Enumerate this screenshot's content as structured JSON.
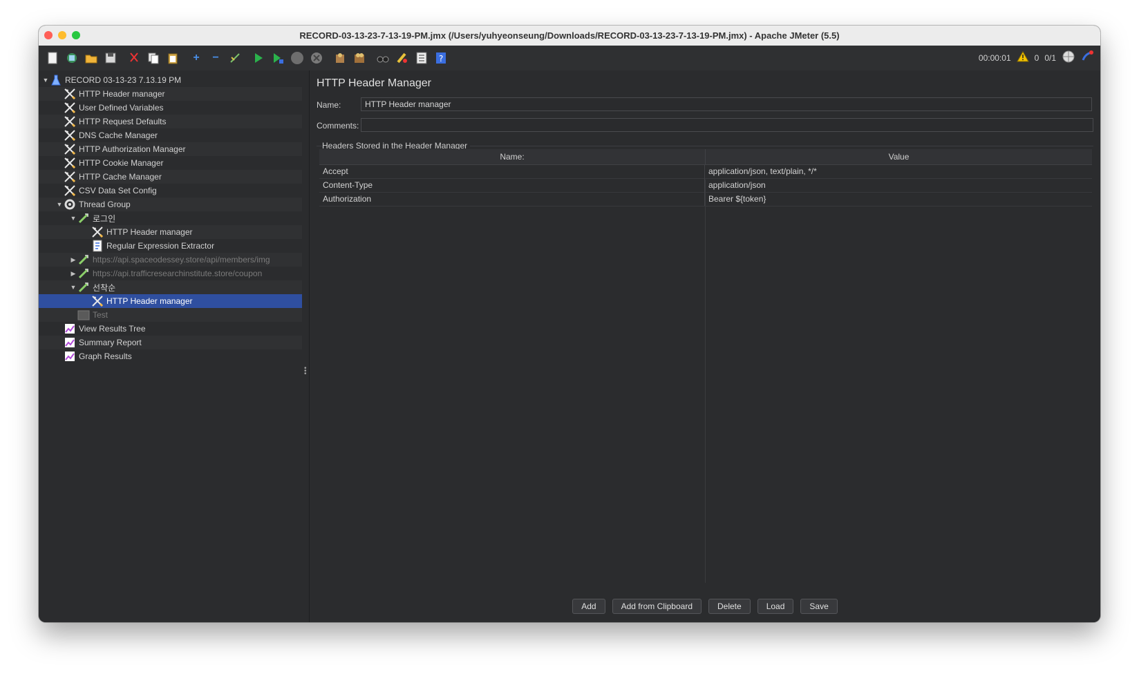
{
  "window": {
    "title": "RECORD-03-13-23-7-13-19-PM.jmx (/Users/yuhyeonseung/Downloads/RECORD-03-13-23-7-13-19-PM.jmx) - Apache JMeter (5.5)"
  },
  "toolbar": {
    "icons": [
      "new-icon",
      "templates-icon",
      "open-icon",
      "save-icon",
      "cut-icon",
      "copy-icon",
      "paste-icon",
      "expand-icon",
      "collapse-icon",
      "toggle-icon",
      "start-icon",
      "start-no-pauses-icon",
      "stop-icon",
      "shutdown-icon",
      "clear-icon",
      "clear-all-icon",
      "search-icon",
      "reset-search-icon",
      "function-helper-icon",
      "help-icon"
    ],
    "elapsed": "00:00:01",
    "warnings": "0",
    "threads": "0/1"
  },
  "tree": {
    "items": [
      {
        "label": "RECORD 03-13-23 7.13.19 PM",
        "icon": "test-plan-icon"
      },
      {
        "label": "HTTP Header manager",
        "icon": "config-element-icon"
      },
      {
        "label": "User Defined Variables",
        "icon": "config-element-icon"
      },
      {
        "label": "HTTP Request Defaults",
        "icon": "config-element-icon"
      },
      {
        "label": "DNS Cache Manager",
        "icon": "config-element-icon"
      },
      {
        "label": "HTTP Authorization Manager",
        "icon": "config-element-icon"
      },
      {
        "label": "HTTP Cookie Manager",
        "icon": "config-element-icon"
      },
      {
        "label": "HTTP Cache Manager",
        "icon": "config-element-icon"
      },
      {
        "label": "CSV Data Set Config",
        "icon": "config-element-icon"
      },
      {
        "label": "Thread Group",
        "icon": "thread-group-icon"
      },
      {
        "label": "로그인",
        "icon": "sampler-icon"
      },
      {
        "label": "HTTP Header manager",
        "icon": "config-element-icon"
      },
      {
        "label": "Regular Expression Extractor",
        "icon": "post-processor-icon"
      },
      {
        "label": "https://api.spaceodessey.store/api/members/img",
        "icon": "sampler-icon"
      },
      {
        "label": "https://api.trafficresearchinstitute.store/coupon",
        "icon": "sampler-icon"
      },
      {
        "label": "선착순",
        "icon": "sampler-icon"
      },
      {
        "label": "HTTP Header manager",
        "icon": "config-element-icon"
      },
      {
        "label": "Test",
        "icon": "disabled-element-icon"
      },
      {
        "label": "View Results Tree",
        "icon": "listener-icon"
      },
      {
        "label": "Summary Report",
        "icon": "listener-icon"
      },
      {
        "label": "Graph Results",
        "icon": "listener-icon"
      }
    ]
  },
  "panel": {
    "title": "HTTP Header Manager",
    "name_label": "Name:",
    "name_value": "HTTP Header manager",
    "comments_label": "Comments:",
    "comments_value": "",
    "group_title": "Headers Stored in the Header Manager",
    "table": {
      "columns": [
        "Name:",
        "Value"
      ],
      "rows": [
        [
          "Accept",
          "application/json, text/plain, */*"
        ],
        [
          "Content-Type",
          "application/json"
        ],
        [
          "Authorization",
          "Bearer ${token}"
        ]
      ]
    },
    "buttons": [
      "Add",
      "Add from Clipboard",
      "Delete",
      "Load",
      "Save"
    ]
  },
  "colors": {
    "selection": "#2f4fa0",
    "background": "#2b2c2e",
    "close": "#ff5f57",
    "minimize": "#febc2e",
    "zoom": "#28c840"
  }
}
